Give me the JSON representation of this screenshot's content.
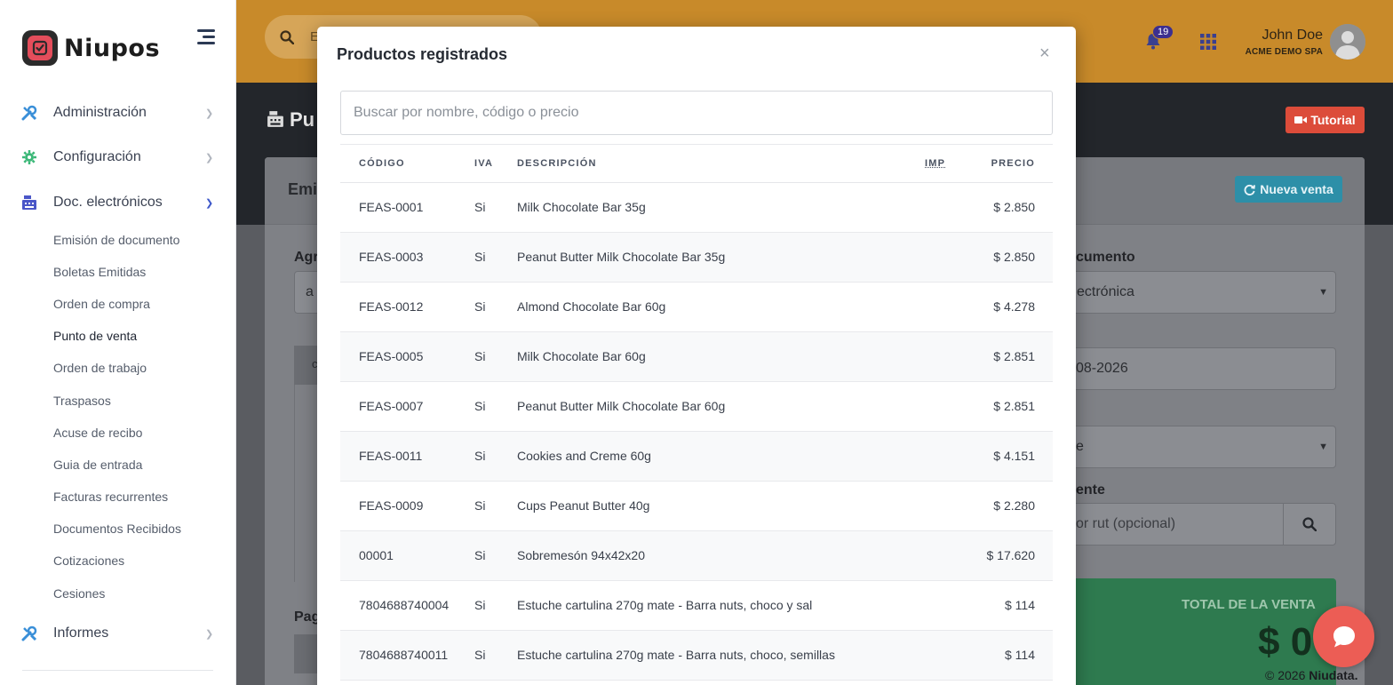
{
  "brand": {
    "name": "Niupos"
  },
  "sidebar": {
    "items": [
      {
        "label": "Administración"
      },
      {
        "label": "Configuración"
      },
      {
        "label": "Doc. electrónicos"
      },
      {
        "label": "Informes"
      }
    ],
    "subitems": [
      "Emisión de documento",
      "Boletas Emitidas",
      "Orden de compra",
      "Punto de venta",
      "Orden de trabajo",
      "Traspasos",
      "Acuse de recibo",
      "Guia de entrada",
      "Facturas recurrentes",
      "Documentos Recibidos",
      "Cotizaciones",
      "Cesiones"
    ],
    "active_subitem": "Punto de venta"
  },
  "topbar": {
    "search_text": "E",
    "notifications_count": "19",
    "user_name": "John Doe",
    "user_org": "ACME DEMO SPA"
  },
  "background": {
    "page_title": "Pu",
    "tutorial_label": "Tutorial",
    "card_title": "Emi",
    "nueva_venta_label": "Nueva venta",
    "agregar_label": "Agre",
    "agregar_field": "a",
    "table_head_initial": "c",
    "pag_label": "Pag",
    "documento_label": "cumento",
    "documento_value": "ectrónica",
    "fecha_value": "08-2026",
    "select_value": "e",
    "cliente_label": "ente",
    "cliente_placeholder": "or rut (opcional)",
    "total_label": "TOTAL DE LA VENTA",
    "total_value": "$ 0",
    "footer_year": "© 2026",
    "footer_brand": "Niudata."
  },
  "modal": {
    "title": "Productos registrados",
    "close_label": "×",
    "search_placeholder": "Buscar por nombre, código o precio",
    "columns": {
      "codigo": "CÓDIGO",
      "iva": "IVA",
      "descripcion": "DESCRIPCIÓN",
      "imp": "IMP",
      "precio": "PRECIO"
    },
    "rows": [
      {
        "codigo": "FEAS-0001",
        "iva": "Si",
        "descripcion": "Milk Chocolate Bar 35g",
        "precio": "$ 2.850"
      },
      {
        "codigo": "FEAS-0003",
        "iva": "Si",
        "descripcion": "Peanut Butter Milk Chocolate Bar 35g",
        "precio": "$ 2.850"
      },
      {
        "codigo": "FEAS-0012",
        "iva": "Si",
        "descripcion": "Almond Chocolate Bar 60g",
        "precio": "$ 4.278"
      },
      {
        "codigo": "FEAS-0005",
        "iva": "Si",
        "descripcion": "Milk Chocolate Bar 60g",
        "precio": "$ 2.851"
      },
      {
        "codigo": "FEAS-0007",
        "iva": "Si",
        "descripcion": "Peanut Butter Milk Chocolate Bar 60g",
        "precio": "$ 2.851"
      },
      {
        "codigo": "FEAS-0011",
        "iva": "Si",
        "descripcion": "Cookies and Creme 60g",
        "precio": "$ 4.151"
      },
      {
        "codigo": "FEAS-0009",
        "iva": "Si",
        "descripcion": "Cups Peanut Butter 40g",
        "precio": "$ 2.280"
      },
      {
        "codigo": "00001",
        "iva": "Si",
        "descripcion": "Sobremesón 94x42x20",
        "precio": "$ 17.620"
      },
      {
        "codigo": "7804688740004",
        "iva": "Si",
        "descripcion": "Estuche cartulina 270g mate - Barra nuts, choco y sal",
        "precio": "$ 114"
      },
      {
        "codigo": "7804688740011",
        "iva": "Si",
        "descripcion": "Estuche cartulina 270g mate - Barra nuts, choco, semillas",
        "precio": "$ 114"
      }
    ]
  },
  "colors": {
    "topbar": "#c88a2a",
    "brand_red": "#e44d5b",
    "tutorial": "#dc4c3a",
    "nueva_venta": "#2d8fa8",
    "total_box": "#2e7a4f",
    "chat": "#ec5d55",
    "sidebar_icon_blue": "#3a8fd8",
    "sidebar_icon_green": "#3cb878",
    "sidebar_icon_indigo": "#4a56c8"
  }
}
